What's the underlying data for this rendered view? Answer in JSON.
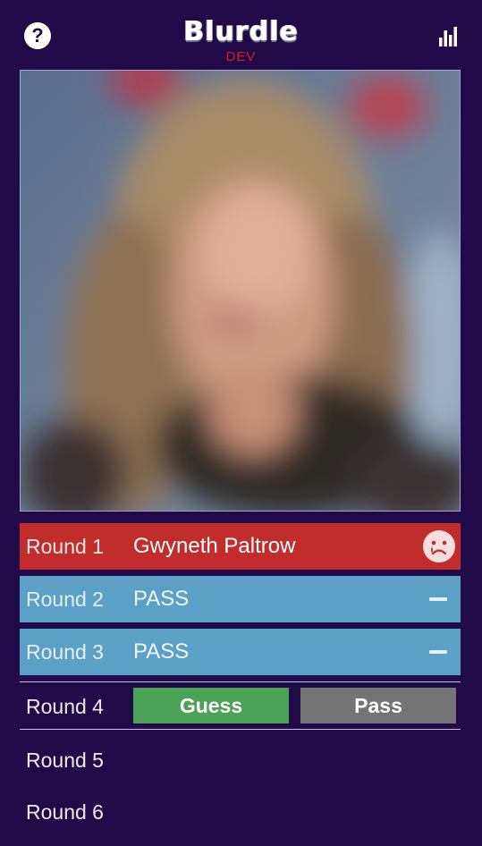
{
  "header": {
    "help_icon": "question-circle-icon",
    "help_glyph": "?",
    "logo_text": "Blurdle",
    "logo_sub": "DEV",
    "stats_icon": "bar-chart-icon"
  },
  "photo": {
    "description_icon": "blurred-photo",
    "blur_level": "heavy"
  },
  "rounds": [
    {
      "label": "Round 1",
      "value": "Gwyneth Paltrow",
      "status": "wrong",
      "status_icon": "sad-face-icon",
      "color": "#c12d2d"
    },
    {
      "label": "Round 2",
      "value": "PASS",
      "status": "passed",
      "status_icon": "dash-icon",
      "color": "#5aa0c7"
    },
    {
      "label": "Round 3",
      "value": "PASS",
      "status": "passed",
      "status_icon": "dash-icon",
      "color": "#5aa0c7"
    },
    {
      "label": "Round 4",
      "status": "active"
    },
    {
      "label": "Round 5",
      "status": "pending"
    },
    {
      "label": "Round 6",
      "status": "pending"
    }
  ],
  "actions": {
    "guess_label": "Guess",
    "pass_label": "Pass",
    "guess_color": "#4aa356",
    "pass_color": "#747474"
  },
  "theme": {
    "background": "#200b48",
    "logo_sub_color": "#e0162a"
  }
}
